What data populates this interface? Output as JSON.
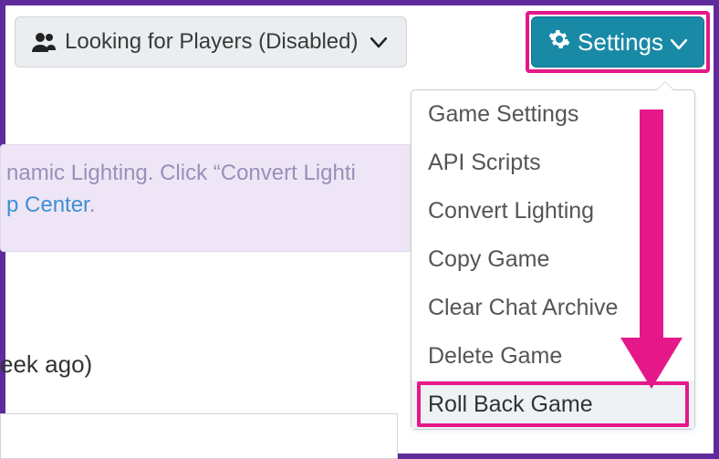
{
  "topbar": {
    "lfp_label": "Looking for Players (Disabled)",
    "settings_label": "Settings"
  },
  "banner": {
    "line1": "namic Lighting. Click “Convert Lighti",
    "link_text": "p Center",
    "period": "."
  },
  "last_played": "eek ago)",
  "dropdown": {
    "items": [
      {
        "label": "Game Settings"
      },
      {
        "label": "API Scripts"
      },
      {
        "label": "Convert Lighting"
      },
      {
        "label": "Copy Game"
      },
      {
        "label": "Clear Chat Archive"
      },
      {
        "label": "Delete Game"
      },
      {
        "label": "Roll Back Game"
      }
    ]
  },
  "annotations": {
    "highlight_color": "#e5188a",
    "frame_color": "#5f2b9c"
  }
}
